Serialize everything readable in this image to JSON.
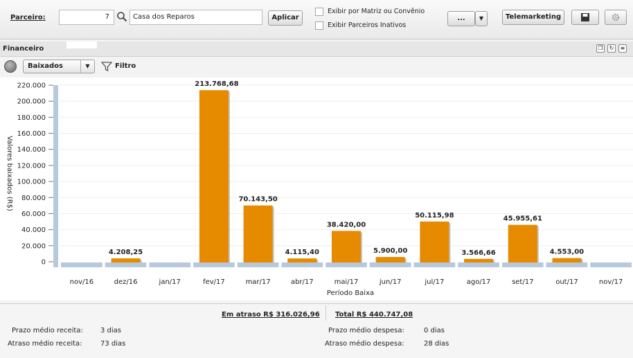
{
  "toolbar": {
    "parceiro_label": "Parceiro:",
    "parceiro_code": "7",
    "parceiro_name": "Casa dos Reparos",
    "apply_label": "Aplicar",
    "check_matriz": "Exibir por Matriz ou Convênio",
    "check_inativos": "Exibir Parceiros Inativos",
    "more_label": "...",
    "telemarketing_label": "Telemarketing"
  },
  "panel": {
    "title": "Financeiro",
    "view_select": "Baixados",
    "filter_label": "Filtro"
  },
  "chart_data": {
    "type": "bar",
    "xlabel": "Período Baixa",
    "ylabel": "Valores baixados (R$)",
    "ylim": [
      0,
      220000
    ],
    "yticks": [
      "0",
      "20.000",
      "40.000",
      "60.000",
      "80.000",
      "100.000",
      "120.000",
      "140.000",
      "160.000",
      "180.000",
      "200.000",
      "220.000"
    ],
    "categories": [
      "nov/16",
      "dez/16",
      "jan/17",
      "fev/17",
      "mar/17",
      "abr/17",
      "mai/17",
      "jun/17",
      "jul/17",
      "ago/17",
      "set/17",
      "out/17",
      "nov/17"
    ],
    "values": [
      0,
      4208.25,
      0,
      213768.68,
      70143.5,
      4115.4,
      38420.0,
      5900.0,
      50115.98,
      3566.66,
      45955.61,
      4553.0,
      0
    ],
    "labels": [
      "",
      "4.208,25",
      "",
      "213.768,68",
      "70.143,50",
      "4.115,40",
      "38.420,00",
      "5.900,00",
      "50.115,98",
      "3.566,66",
      "45.955,61",
      "4.553,00",
      ""
    ],
    "bar_color": "#e68a00",
    "grid": true
  },
  "footer": {
    "em_atraso": "Em atraso R$ 316.026,96",
    "total": "Total R$ 440.747,08",
    "prazo_receita_label": "Prazo médio receita:",
    "prazo_receita_value": "3 dias",
    "atraso_receita_label": "Atraso médio receita:",
    "atraso_receita_value": "73 dias",
    "prazo_despesa_label": "Prazo médio despesa:",
    "prazo_despesa_value": "0 dias",
    "atraso_despesa_label": "Atraso médio despesa:",
    "atraso_despesa_value": "28 dias"
  }
}
